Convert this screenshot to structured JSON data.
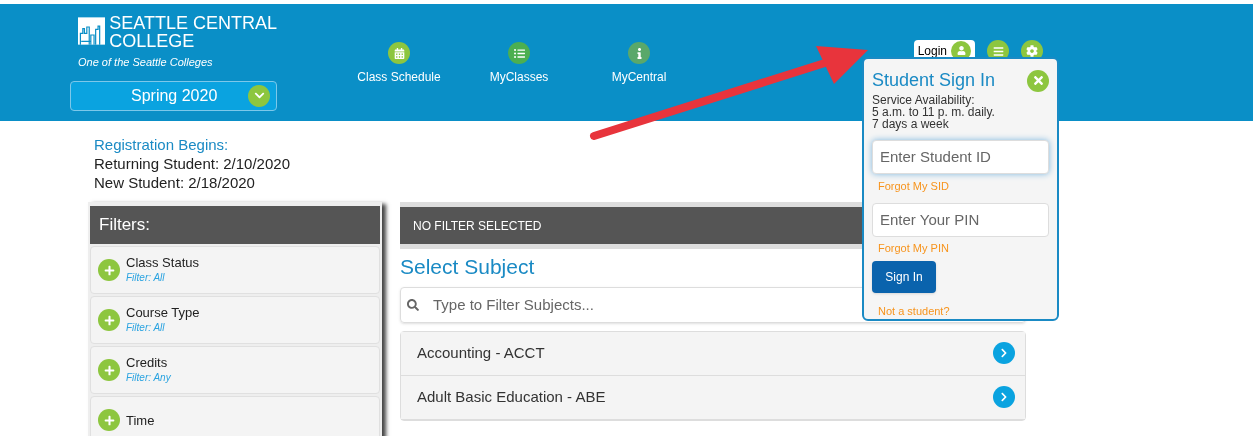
{
  "header": {
    "logo_line_1": "SEATTLE CENTRAL",
    "logo_line_2": "COLLEGE",
    "tagline": "One of the Seattle Colleges",
    "term": "Spring 2020",
    "nav": [
      {
        "label": "Class Schedule",
        "kind": "calendar"
      },
      {
        "label": "MyClasses",
        "kind": "list"
      },
      {
        "label": "MyCentral",
        "kind": "info"
      }
    ],
    "login": "Login"
  },
  "registration": {
    "title": "Registration Begins:",
    "lines": [
      "Returning Student: 2/10/2020",
      "New Student: 2/18/2020"
    ]
  },
  "filters": {
    "title": "Filters:",
    "items": [
      {
        "label": "Class Status",
        "sub": "Filter: All"
      },
      {
        "label": "Course Type",
        "sub": "Filter: All"
      },
      {
        "label": "Credits",
        "sub": "Filter: Any"
      },
      {
        "label": "Time"
      }
    ]
  },
  "main": {
    "bar": "NO FILTER SELECTED",
    "title": "Select Subject",
    "search": {
      "placeholder": "Type to Filter Subjects..."
    },
    "subjects": [
      "Accounting - ACCT",
      "Adult Basic Education - ABE"
    ]
  },
  "signin": {
    "title": "Student Sign In",
    "availability": [
      "Service Availability:",
      "5 a.m. to 11 p. m. daily.",
      "7 days a week"
    ],
    "id_field": {
      "placeholder": "Enter Student ID"
    },
    "id_link": "Forgot My SID",
    "pin_field": {
      "placeholder": "Enter Your PIN"
    },
    "pin_link": "Forgot My PIN",
    "button": "Sign In",
    "other": "Not a student?"
  }
}
